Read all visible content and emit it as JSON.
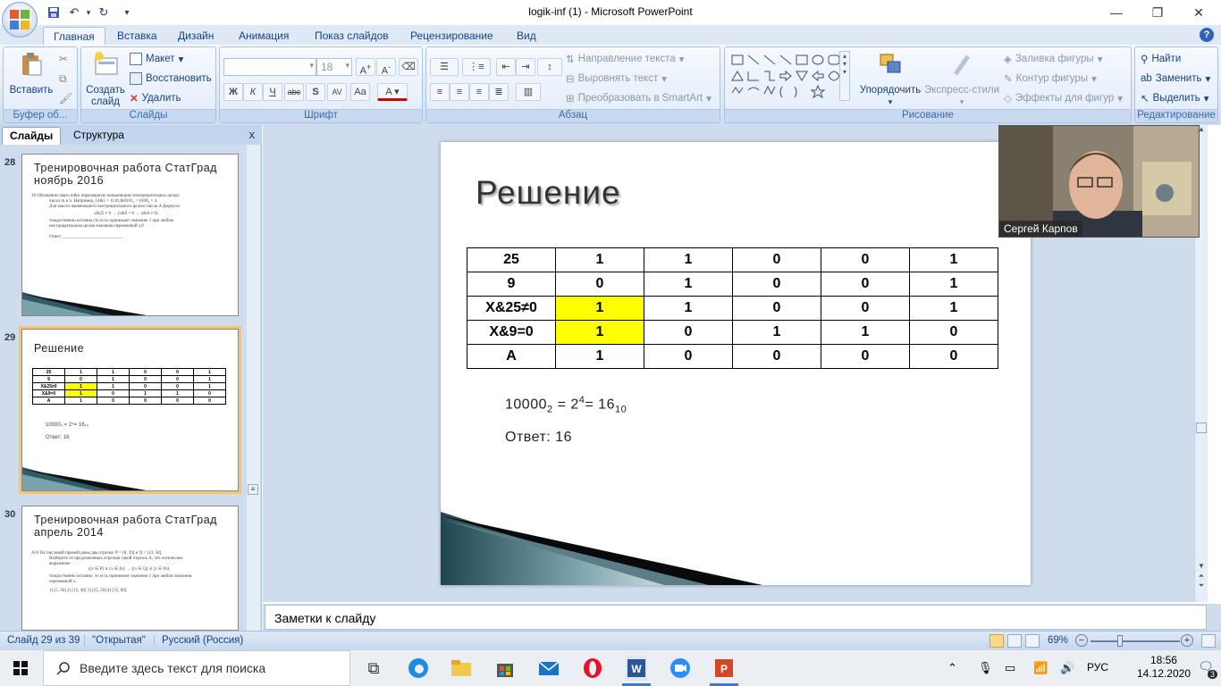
{
  "window": {
    "title": "logik-inf (1) - Microsoft PowerPoint",
    "minimize": "—",
    "restore": "❐",
    "close": "✕"
  },
  "tabs": [
    "Главная",
    "Вставка",
    "Дизайн",
    "Анимация",
    "Показ слайдов",
    "Рецензирование",
    "Вид"
  ],
  "ribbon": {
    "clipboard": {
      "paste": "Вставить",
      "label": "Буфер об..."
    },
    "slides": {
      "new_slide_1": "Создать",
      "new_slide_2": "слайд",
      "layout": "Макет",
      "reset": "Восстановить",
      "delete": "Удалить",
      "label": "Слайды"
    },
    "font": {
      "size": "18",
      "label": "Шрифт"
    },
    "paragraph": {
      "text_direction": "Направление текста",
      "align_text": "Выровнять текст",
      "smartart": "Преобразовать в SmartArt",
      "label": "Абзац"
    },
    "drawing": {
      "arrange": "Упорядочить",
      "quick_styles": "Экспресс-стили",
      "fill": "Заливка фигуры",
      "outline": "Контур фигуры",
      "effects": "Эффекты для фигур",
      "label": "Рисование"
    },
    "editing": {
      "find": "Найти",
      "replace": "Заменить",
      "select": "Выделить",
      "label": "Редактирование"
    }
  },
  "left_panel": {
    "tab_slides": "Слайды",
    "tab_outline": "Структура",
    "close": "x",
    "thumbs": [
      {
        "num": "28",
        "title": "Тренировочная работа СтатГрад ноябрь 2016",
        "text": [
          "18   Обозначим через m&n поразрядную конъюнкцию неотрицательных целых",
          "чисел m и n. Например, 14&5 = 1110₂&0101₂ = 0100₂ = 4.",
          "Для какого наименьшего неотрицательного целого числа А формула",
          "x&25 ≠ 0 → (x&9 = 0 → x&A ≠ 0)",
          "тождественно истинна (то есть принимает значение 1 при любом",
          "неотрицательном целом значении переменной х)?",
          "",
          "Ответ: ___________________________"
        ]
      },
      {
        "num": "29",
        "title": "Решение",
        "formula": "10000₂ = 2⁴= 16₁₀",
        "answer": "Ответ: 16"
      },
      {
        "num": "30",
        "title": "Тренировочная работа СтатГрад апрель 2014",
        "text": [
          "A10  На числовой прямой даны два отрезка: P = [8, 39] и Q = [23, 58].",
          "Выберите из предложенных отрезков такой отрезок A, что логическое",
          "выражение",
          "((x ∈ P) ∨ (x ∈ A)) → ((x ∈ Q) ∨ (x ∈ A))",
          "тождественно истинно, то есть принимает значение 1 при любом значении",
          "переменной x.",
          "",
          "1)  [5, 30]        2)  [15, 40]        3)  [25, 50]        4)  [35, 60]"
        ]
      }
    ]
  },
  "slide": {
    "title": "Решение",
    "table": [
      [
        "25",
        "1",
        "1",
        "0",
        "0",
        "1"
      ],
      [
        "9",
        "0",
        "1",
        "0",
        "0",
        "1"
      ],
      [
        "X&25≠0",
        "1",
        "1",
        "0",
        "0",
        "1"
      ],
      [
        "X&9=0",
        "1",
        "0",
        "1",
        "1",
        "0"
      ],
      [
        "A",
        "1",
        "0",
        "0",
        "0",
        "0"
      ]
    ],
    "highlight_color": "#ffff00",
    "formula_base": "10000",
    "formula_sub": "2",
    "formula_mid": " = 2",
    "formula_sup": "4",
    "formula_end": "= 16",
    "formula_sub2": "10",
    "answer": "Ответ: 16"
  },
  "webcam": {
    "name": "Сергей Карпов"
  },
  "notes": {
    "placeholder": "Заметки к слайду"
  },
  "status": {
    "slide": "Слайд 29 из 39",
    "theme": "\"Открытая\"",
    "language": "Русский (Россия)",
    "zoom": "69%"
  },
  "taskbar": {
    "search": "Введите здесь текст для поиска",
    "lang": "РУС",
    "time": "18:56",
    "date": "14.12.2020",
    "notifications": "3"
  }
}
